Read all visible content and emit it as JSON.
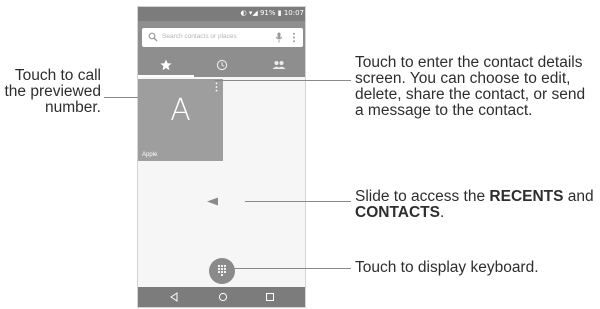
{
  "phone": {
    "status_text": "◐ ▾◢ 91% ▮ 10:07",
    "search_placeholder": "Search contacts or places",
    "tabs": [
      {
        "icon": "star-icon",
        "active": true
      },
      {
        "icon": "clock-icon",
        "active": false
      },
      {
        "icon": "people-icon",
        "active": false
      }
    ],
    "favorite": {
      "initial": "A",
      "name": "Apple"
    },
    "nav_icons": [
      "back-icon",
      "home-icon",
      "recents-icon"
    ]
  },
  "callouts": {
    "left": "Touch to call the previewed number.",
    "details": "Touch to enter the contact details screen. You can choose to edit, delete, share the contact, or send a message to the contact.",
    "slide": {
      "prefix": "Slide to access the ",
      "recents": "RECENTS",
      "and": " and ",
      "contacts": "CONTACTS",
      "end": "."
    },
    "keyboard": "Touch to display keyboard."
  },
  "colors": {
    "bar": "#8e8e8e",
    "card": "#9e9e9e",
    "text": "#2e2e2e"
  }
}
